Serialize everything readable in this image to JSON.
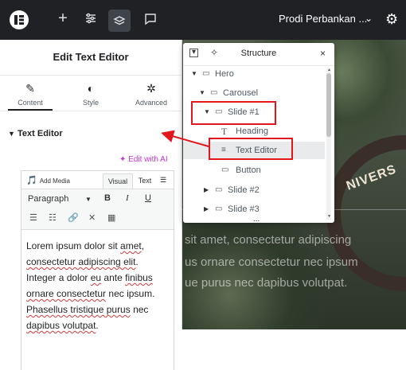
{
  "topbar": {
    "logo_icon": "elementor-logo",
    "add_icon": "+",
    "settings_icon": "≡",
    "site_title": "Prodi Perbankan ...",
    "chevron": "⌄",
    "gear": "⚙"
  },
  "panel": {
    "title": "Edit Text Editor",
    "tabs": [
      {
        "label": "Content",
        "icon": "✎"
      },
      {
        "label": "Style",
        "icon": "◐"
      },
      {
        "label": "Advanced",
        "icon": "✲"
      }
    ],
    "section_title": "Text Editor",
    "edit_with_ai": "✦ Edit with AI",
    "editor": {
      "add_media": "Add Media",
      "visual_tab": "Visual",
      "text_tab": "Text",
      "format": "Paragraph",
      "bold": "B",
      "italic": "I",
      "underline": "U",
      "content_parts": [
        {
          "t": "Lorem ipsum dolor sit "
        },
        {
          "t": "amet",
          "sq": true
        },
        {
          "t": ", "
        },
        {
          "t": "consectetur adipiscing elit",
          "sq": true
        },
        {
          "t": ". Integer a dolor "
        },
        {
          "t": "eu",
          "sq": true
        },
        {
          "t": " ante "
        },
        {
          "t": "finibus",
          "sq": true
        },
        {
          "t": " "
        },
        {
          "t": "ornare consectetur",
          "sq": true
        },
        {
          "t": " nec ipsum. "
        },
        {
          "t": "Phasellus tristique purus",
          "sq": true
        },
        {
          "t": " nec "
        },
        {
          "t": "dapibus volutpat",
          "sq": true
        },
        {
          "t": "."
        }
      ]
    }
  },
  "structure": {
    "title": "Structure",
    "close": "×",
    "rows": [
      {
        "label": "Hero",
        "twisty": "▼",
        "icon": "▭"
      },
      {
        "label": "Carousel",
        "twisty": "▼",
        "icon": "▭"
      },
      {
        "label": "Slide #1",
        "twisty": "▼",
        "icon": "▭"
      },
      {
        "label": "Heading",
        "twisty": "",
        "icon": "T"
      },
      {
        "label": "Text Editor",
        "twisty": "",
        "icon": "≡"
      },
      {
        "label": "Button",
        "twisty": "",
        "icon": "▭"
      },
      {
        "label": "Slide #2",
        "twisty": "▶",
        "icon": "▭"
      },
      {
        "label": "Slide #3",
        "twisty": "▶",
        "icon": "▭"
      }
    ],
    "more": "..."
  },
  "preview": {
    "gate_text": "NIVERS",
    "overlay_lines": [
      "sit amet, consectetur adipiscing",
      "us ornare consectetur nec ipsum",
      "ue purus nec dapibus volutpat."
    ]
  },
  "colors": {
    "accent_ai": "#c036d1",
    "annotation_red": "#e3161d",
    "topbar_bg": "#1f2124"
  }
}
